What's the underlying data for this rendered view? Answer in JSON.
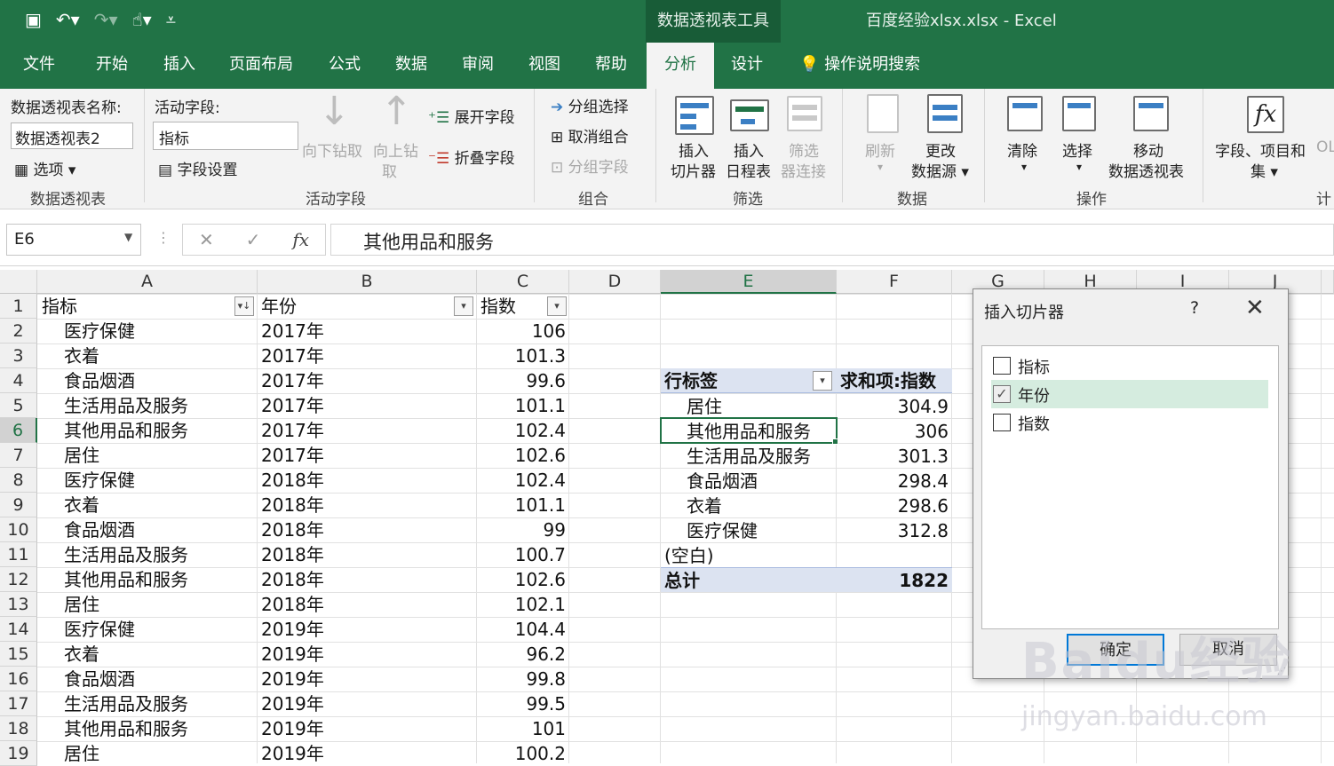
{
  "title": {
    "context": "数据透视表工具",
    "doc": "百度经验xlsx.xlsx  -  Excel"
  },
  "tabs": [
    "文件",
    "开始",
    "插入",
    "页面布局",
    "公式",
    "数据",
    "审阅",
    "视图",
    "帮助",
    "分析",
    "设计"
  ],
  "tellme": "操作说明搜索",
  "ribbon": {
    "pt_name_label": "数据透视表名称:",
    "pt_name_value": "数据透视表2",
    "options": "选项",
    "grp1": "数据透视表",
    "active_field_label": "活动字段:",
    "active_field_value": "指标",
    "field_settings": "字段设置",
    "drill_down": "向下钻取",
    "drill_up": "向上钻",
    "drill_up2": "取",
    "expand": "展开字段",
    "collapse": "折叠字段",
    "grp2": "活动字段",
    "group_sel": "分组选择",
    "ungroup": "取消组合",
    "group_field": "分组字段",
    "grp3": "组合",
    "slicer1": "插入",
    "slicer2": "切片器",
    "timeline1": "插入",
    "timeline2": "日程表",
    "filterconn1": "筛选",
    "filterconn2": "器连接",
    "grp4": "筛选",
    "refresh": "刷新",
    "changesrc1": "更改",
    "changesrc2": "数据源",
    "grp5": "数据",
    "clear": "清除",
    "select": "选择",
    "move1": "移动",
    "move2": "数据透视表",
    "grp6": "操作",
    "fields1": "字段、项目和",
    "fields2": "集",
    "grp7": "计"
  },
  "formula_bar": {
    "namebox": "E6",
    "fx": "fx",
    "content": "其他用品和服务"
  },
  "columns": [
    "A",
    "B",
    "C",
    "D",
    "E",
    "F",
    "G",
    "H",
    "I",
    "J"
  ],
  "rows": [
    "1",
    "2",
    "3",
    "4",
    "5",
    "6",
    "7",
    "8",
    "9",
    "10",
    "11",
    "12",
    "13",
    "14",
    "15",
    "16",
    "17",
    "18",
    "19"
  ],
  "headers": [
    "指标",
    "年份",
    "指数"
  ],
  "table": [
    [
      "医疗保健",
      "2017年",
      "106"
    ],
    [
      "衣着",
      "2017年",
      "101.3"
    ],
    [
      "食品烟酒",
      "2017年",
      "99.6"
    ],
    [
      "生活用品及服务",
      "2017年",
      "101.1"
    ],
    [
      "其他用品和服务",
      "2017年",
      "102.4"
    ],
    [
      "居住",
      "2017年",
      "102.6"
    ],
    [
      "医疗保健",
      "2018年",
      "102.4"
    ],
    [
      "衣着",
      "2018年",
      "101.1"
    ],
    [
      "食品烟酒",
      "2018年",
      "99"
    ],
    [
      "生活用品及服务",
      "2018年",
      "100.7"
    ],
    [
      "其他用品和服务",
      "2018年",
      "102.6"
    ],
    [
      "居住",
      "2018年",
      "102.1"
    ],
    [
      "医疗保健",
      "2019年",
      "104.4"
    ],
    [
      "衣着",
      "2019年",
      "96.2"
    ],
    [
      "食品烟酒",
      "2019年",
      "99.8"
    ],
    [
      "生活用品及服务",
      "2019年",
      "99.5"
    ],
    [
      "其他用品和服务",
      "2019年",
      "101"
    ],
    [
      "居住",
      "2019年",
      "100.2"
    ]
  ],
  "pivot": {
    "row_label": "行标签",
    "value_label": "求和项:指数",
    "items": [
      [
        "居住",
        "304.9"
      ],
      [
        "其他用品和服务",
        "306"
      ],
      [
        "生活用品及服务",
        "301.3"
      ],
      [
        "食品烟酒",
        "298.4"
      ],
      [
        "衣着",
        "298.6"
      ],
      [
        "医疗保健",
        "312.8"
      ]
    ],
    "blank": "(空白)",
    "total_label": "总计",
    "total": "1822"
  },
  "dialog": {
    "title": "插入切片器",
    "help": "?",
    "fields": [
      {
        "label": "指标",
        "checked": false
      },
      {
        "label": "年份",
        "checked": true
      },
      {
        "label": "指数",
        "checked": false
      }
    ],
    "ok": "确定",
    "cancel": "取消"
  },
  "watermark": {
    "brand": "Baidu经验",
    "url": "jingyan.baidu.com"
  }
}
